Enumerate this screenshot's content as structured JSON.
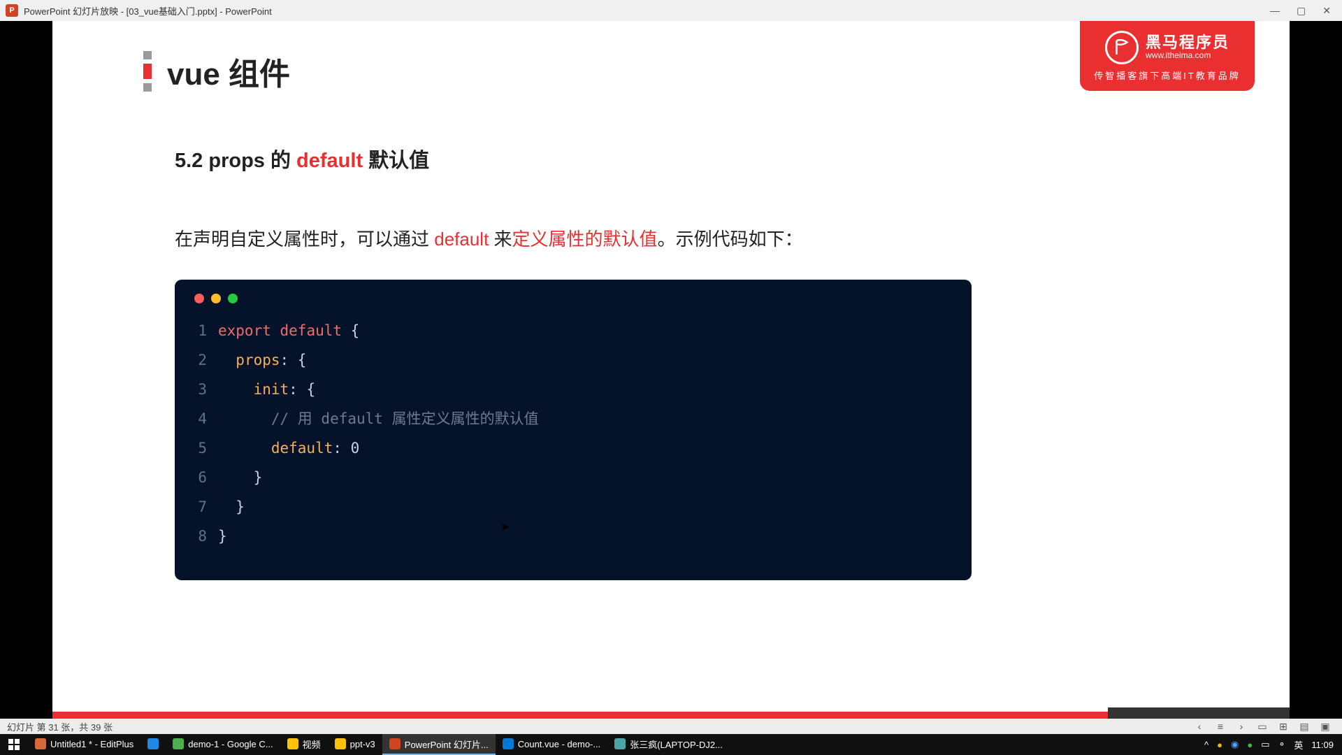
{
  "window": {
    "title": "PowerPoint 幻灯片放映 - [03_vue基础入门.pptx] - PowerPoint",
    "app_icon": "P"
  },
  "slide": {
    "header": "vue 组件",
    "subtitle_prefix": "5.2 props 的 ",
    "subtitle_accent": "default",
    "subtitle_suffix": " 默认值",
    "desc_1": "在声明自定义属性时，可以通过 ",
    "desc_accent1": "default",
    "desc_2": " 来",
    "desc_accent2": "定义属性的默认值",
    "desc_3": "。示例代码如下：",
    "code": [
      {
        "n": "1",
        "segments": [
          {
            "t": "export",
            "c": "kw"
          },
          {
            "t": " ",
            "c": "pl"
          },
          {
            "t": "default",
            "c": "kw"
          },
          {
            "t": " {",
            "c": "pl"
          }
        ]
      },
      {
        "n": "2",
        "segments": [
          {
            "t": "  ",
            "c": "pl"
          },
          {
            "t": "props",
            "c": "ky"
          },
          {
            "t": ": {",
            "c": "pl"
          }
        ]
      },
      {
        "n": "3",
        "segments": [
          {
            "t": "    ",
            "c": "pl"
          },
          {
            "t": "init",
            "c": "ky"
          },
          {
            "t": ": {",
            "c": "pl"
          }
        ]
      },
      {
        "n": "4",
        "segments": [
          {
            "t": "      ",
            "c": "pl"
          },
          {
            "t": "// 用 default 属性定义属性的默认值",
            "c": "cm"
          }
        ]
      },
      {
        "n": "5",
        "segments": [
          {
            "t": "      ",
            "c": "pl"
          },
          {
            "t": "default",
            "c": "ky"
          },
          {
            "t": ": ",
            "c": "pl"
          },
          {
            "t": "0",
            "c": "pl"
          }
        ]
      },
      {
        "n": "6",
        "segments": [
          {
            "t": "    }",
            "c": "pl"
          }
        ]
      },
      {
        "n": "7",
        "segments": [
          {
            "t": "  }",
            "c": "pl"
          }
        ]
      },
      {
        "n": "8",
        "segments": [
          {
            "t": "}",
            "c": "pl"
          }
        ]
      }
    ]
  },
  "brand": {
    "cn": "黑马程序员",
    "url": "www.itheima.com",
    "sub": "传智播客旗下高端IT教育品牌"
  },
  "status": {
    "text": "幻灯片 第 31 张，共 39 张"
  },
  "taskbar": {
    "items": [
      {
        "label": "Untitled1 * - EditPlus",
        "color": "#d86a3a"
      },
      {
        "label": "",
        "color": "#1e88e5",
        "icon_only": true
      },
      {
        "label": "demo-1 - Google C...",
        "color": "#4caf50"
      },
      {
        "label": "视频",
        "color": "#ffc107"
      },
      {
        "label": "ppt-v3",
        "color": "#ffc107"
      },
      {
        "label": "PowerPoint 幻灯片...",
        "color": "#d04424",
        "active": true
      },
      {
        "label": "Count.vue - demo-...",
        "color": "#0078d4"
      },
      {
        "label": "张三疯(LAPTOP-DJ2...",
        "color": "#4da6a6"
      }
    ],
    "ime": "英",
    "time": "11:09"
  }
}
